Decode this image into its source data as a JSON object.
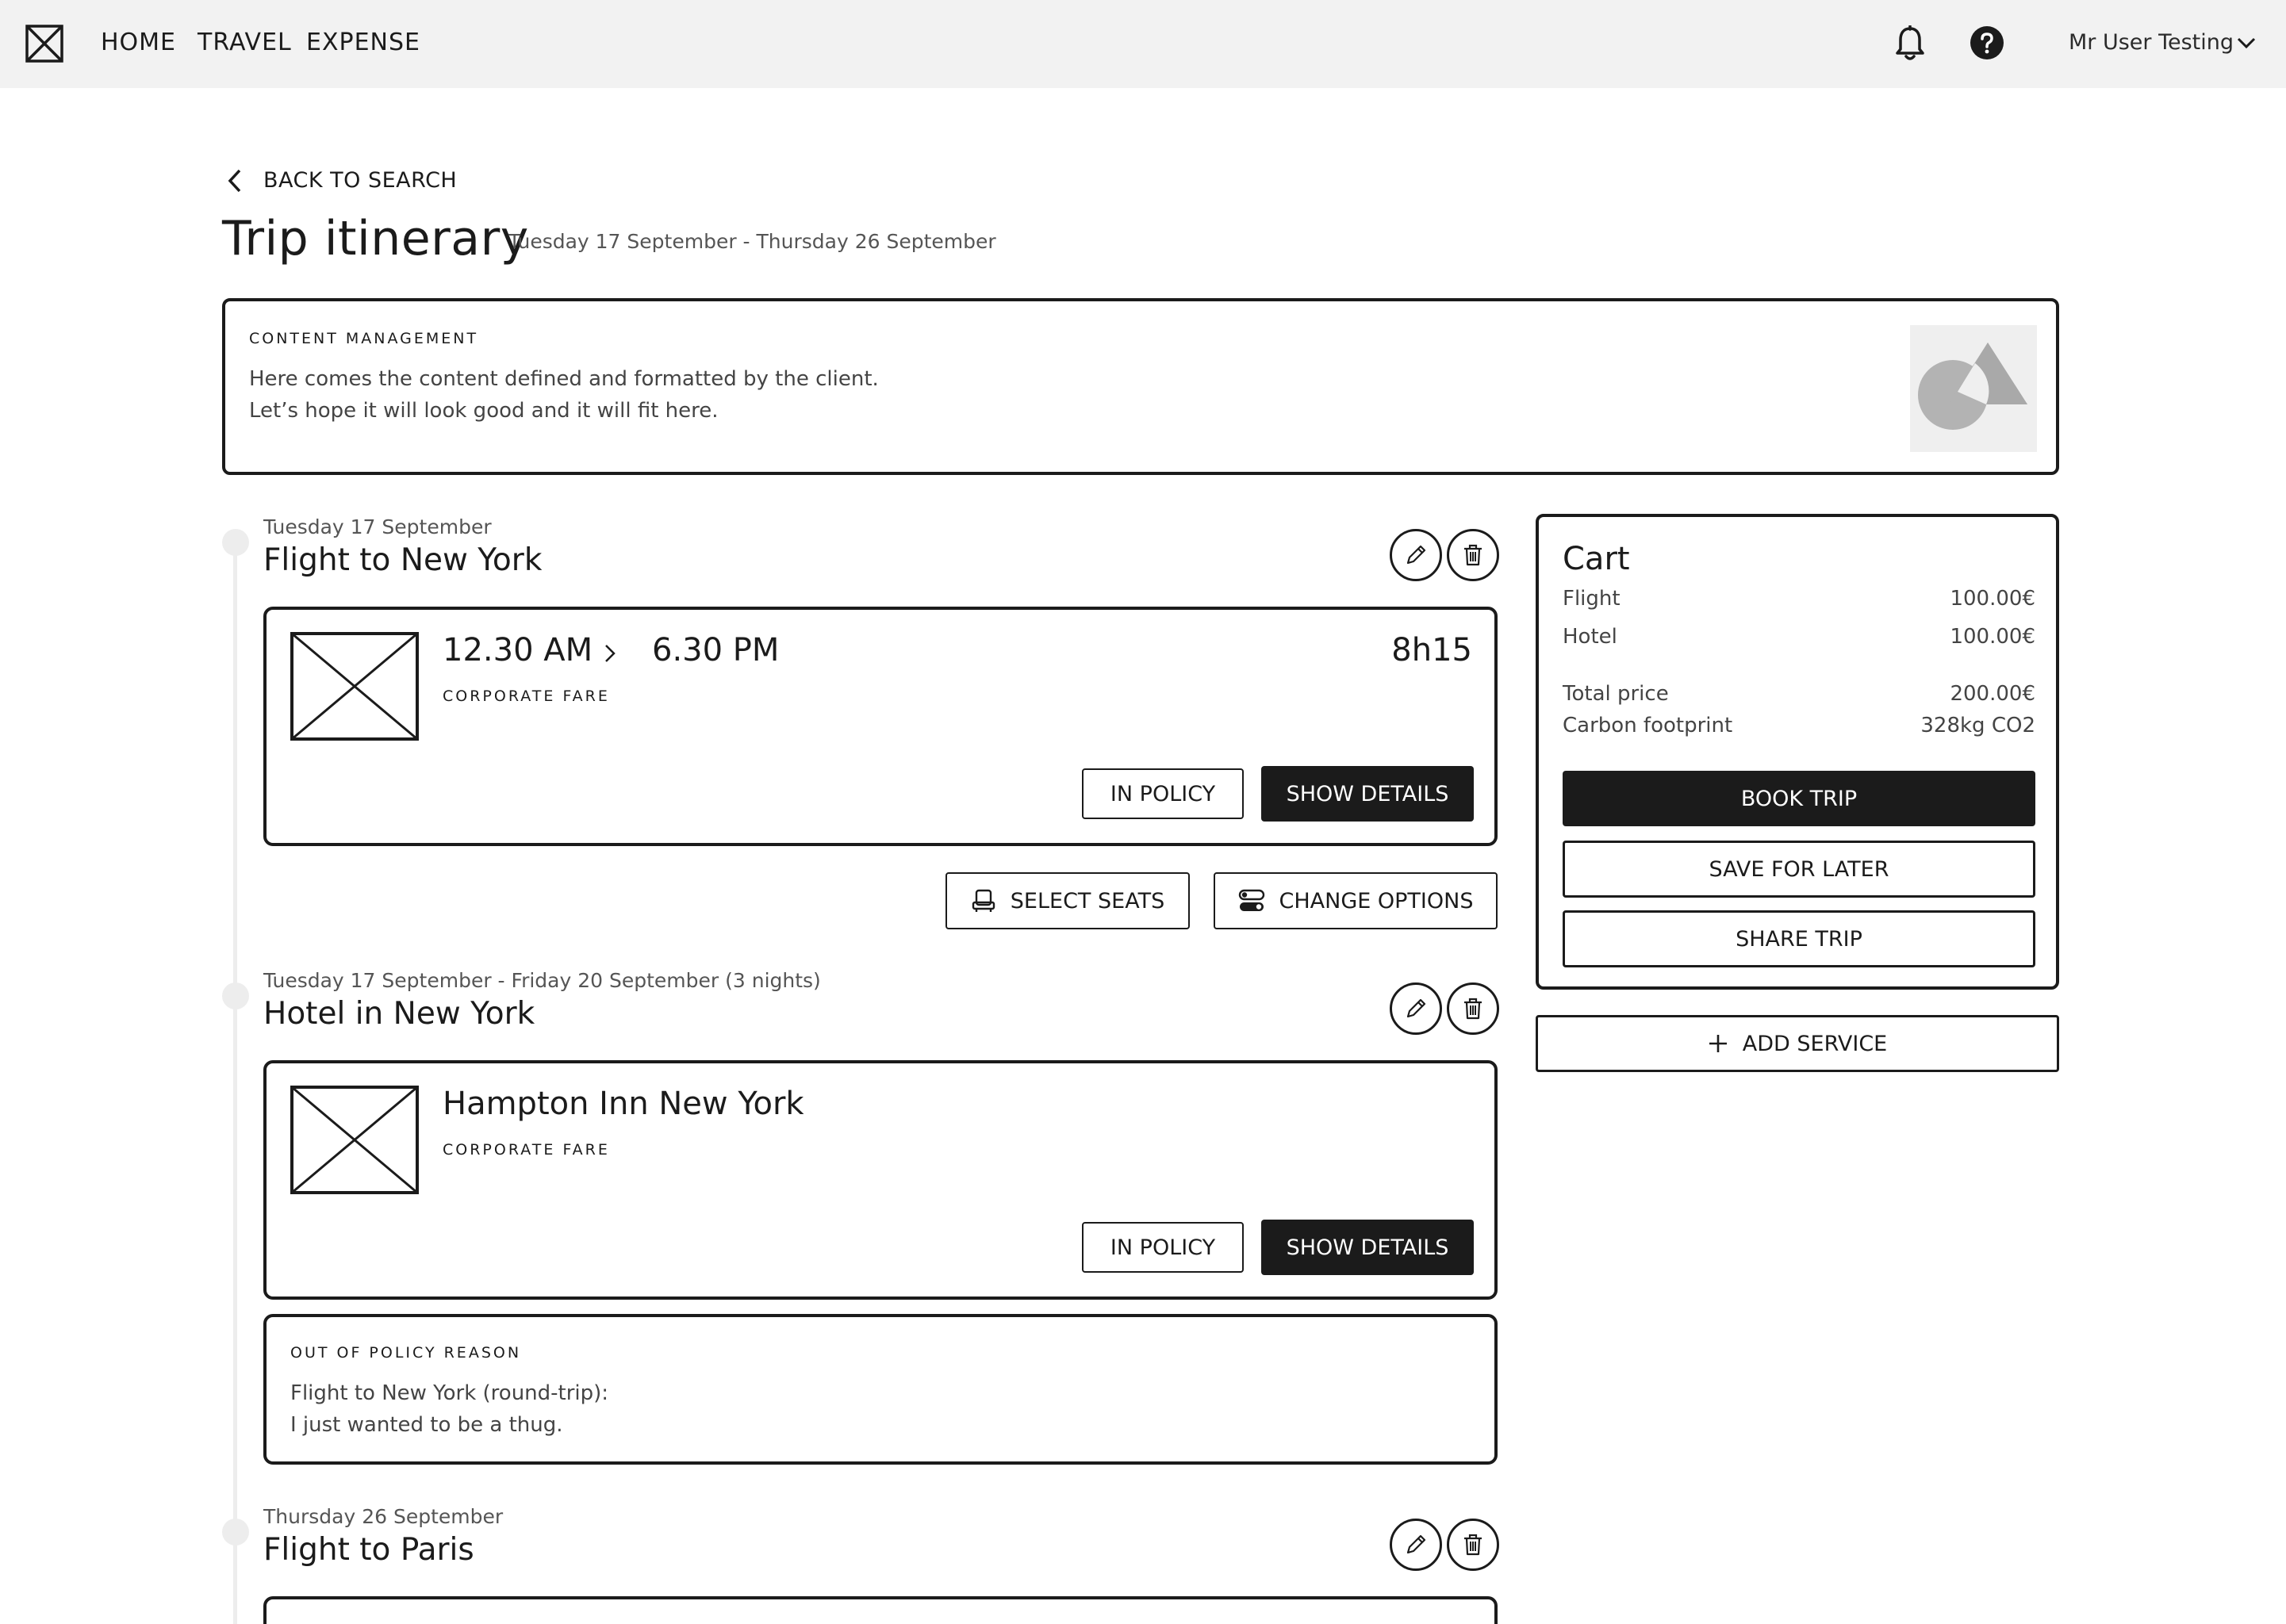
{
  "topbar": {
    "nav": [
      "HOME",
      "TRAVEL",
      "EXPENSE"
    ],
    "user_name": "Mr User Testing",
    "icons": {
      "logo": "logo-icon",
      "bell": "bell-icon",
      "help": "help-icon",
      "user_menu": "chevron-down-icon"
    }
  },
  "header": {
    "back_label": "BACK TO SEARCH",
    "title": "Trip itinerary",
    "dates": "Tuesday 17 September - Thursday 26 September"
  },
  "cms": {
    "label": "CONTENT MANAGEMENT",
    "line1": "Here comes the content defined and formatted by the client.",
    "line2": "Let’s hope it will look good and it will fit here."
  },
  "segments": [
    {
      "date": "Tuesday 17 September",
      "title": "Flight to New York",
      "depart": "12.30 AM",
      "arrive": "6.30 PM",
      "duration": "8h15",
      "fare": "CORPORATE FARE",
      "policy_label": "IN POLICY",
      "details_label": "SHOW DETAILS",
      "select_seats_label": "SELECT SEATS",
      "change_options_label": "CHANGE OPTIONS"
    },
    {
      "date": "Tuesday 17 September - Friday 20 September (3 nights)",
      "title": "Hotel in New York",
      "name": "Hampton Inn New York",
      "fare": "CORPORATE FARE",
      "policy_label": "IN POLICY",
      "details_label": "SHOW DETAILS",
      "reason_label": "OUT OF POLICY REASON",
      "reason_line1": "Flight to New York (round-trip):",
      "reason_line2": "I just wanted to be a thug."
    },
    {
      "date": "Thursday 26 September",
      "title": "Flight to Paris"
    }
  ],
  "cart": {
    "title": "Cart",
    "flight_label": "Flight",
    "flight_price": "100.00€",
    "hotel_label": "Hotel",
    "hotel_price": "100.00€",
    "total_label": "Total price",
    "total_price": "200.00€",
    "carbon_label": "Carbon footprint",
    "carbon_value": "328kg CO2",
    "book_label": "BOOK TRIP",
    "save_label": "SAVE FOR LATER",
    "share_label": "SHARE TRIP"
  },
  "add_service_label": "ADD SERVICE",
  "colors": {
    "ink": "#1b1b1b",
    "topbar_bg": "#f2f2f2",
    "timeline": "#ededed",
    "muted_text": "#555555"
  }
}
